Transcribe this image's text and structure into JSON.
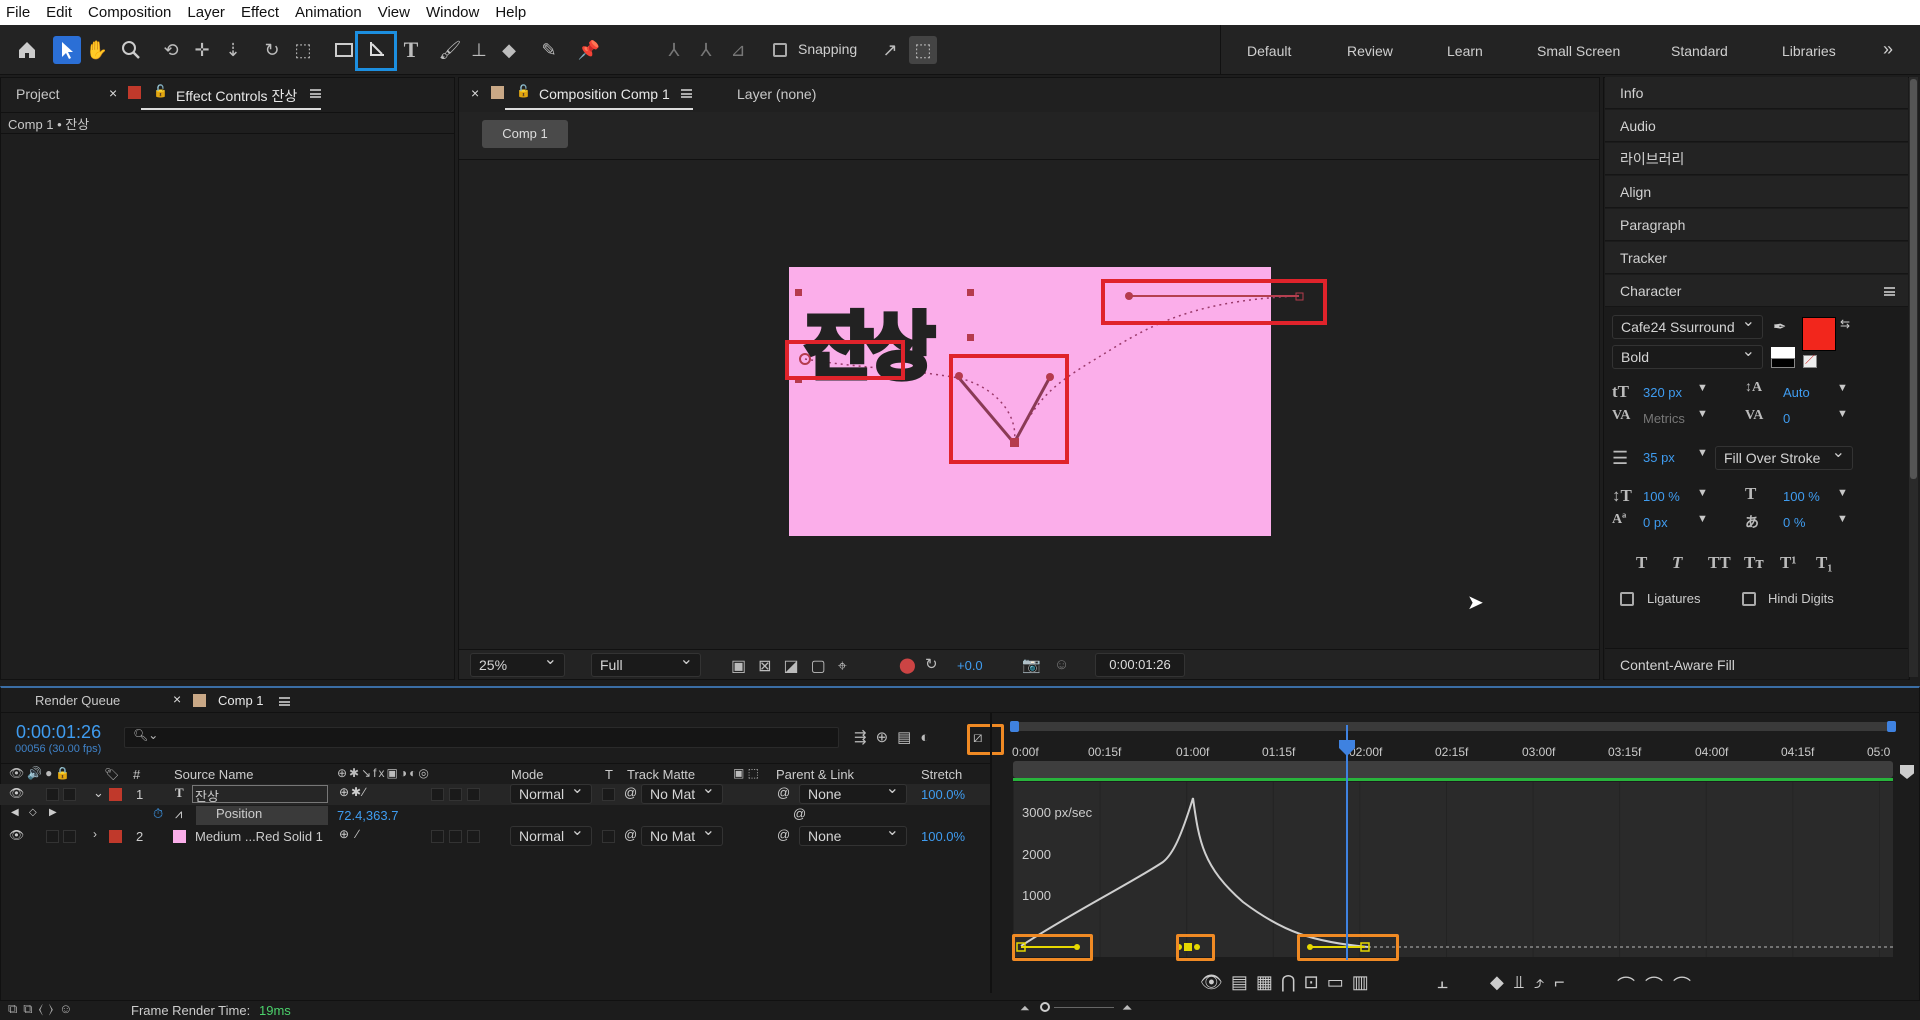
{
  "menu": [
    "File",
    "Edit",
    "Composition",
    "Layer",
    "Effect",
    "Animation",
    "View",
    "Window",
    "Help"
  ],
  "toolbar": {
    "snapping": "Snapping",
    "workspaces": [
      "Default",
      "Review",
      "Learn",
      "Small Screen",
      "Standard",
      "Libraries"
    ],
    "more": "»"
  },
  "left_panel": {
    "tab_project": "Project",
    "tab_effect": "Effect Controls 잔상",
    "breadcrumb": "Comp 1 • 잔상"
  },
  "comp_panel": {
    "tab_comp": "Composition Comp 1",
    "tab_layer": "Layer (none)",
    "comp_chip": "Comp 1",
    "text_layer": "잔상",
    "zoom": "25%",
    "resolution": "Full",
    "exposure": "+0.0",
    "timecode": "0:00:01:26"
  },
  "right_panel": {
    "items": [
      "Info",
      "Audio",
      "라이브러리",
      "Align",
      "Paragraph",
      "Tracker"
    ],
    "character": "Character",
    "font": "Cafe24 Ssurround",
    "style": "Bold",
    "size": "320 px",
    "leading": "Auto",
    "kerning": "Metrics",
    "tracking": "0",
    "stroke_w": "35 px",
    "stroke_type": "Fill Over Stroke",
    "vscale": "100 %",
    "hscale": "100 %",
    "baseline": "0 px",
    "tsume": "0 %",
    "type_buttons": [
      "T",
      "T",
      "TT",
      "Tт",
      "T¹",
      "T₁"
    ],
    "ligatures": "Ligatures",
    "hindi": "Hindi Digits",
    "caf": "Content-Aware Fill",
    "fill_color": "#f2261c"
  },
  "timeline": {
    "tab_rq": "Render Queue",
    "tab_comp": "Comp 1",
    "timecode": "0:00:01:26",
    "frames": "00056 (30.00 fps)",
    "cols": {
      "num": "#",
      "source": "Source Name",
      "mode": "Mode",
      "t": "T",
      "track": "Track Matte",
      "parent": "Parent & Link",
      "stretch": "Stretch"
    },
    "layers": [
      {
        "num": "1",
        "type": "T",
        "name": "잔상",
        "mode": "Normal",
        "matte": "No Mat",
        "parent": "None",
        "stretch": "100.0%",
        "color": "#c0392b"
      },
      {
        "num": "2",
        "type": "",
        "name": "Medium ...Red Solid 1",
        "mode": "Normal",
        "matte": "No Mat",
        "parent": "None",
        "stretch": "100.0%",
        "color": "#c0392b"
      }
    ],
    "property": {
      "name": "Position",
      "value": "72.4,363.7"
    },
    "ruler": [
      "0:00f",
      "00:15f",
      "01:00f",
      "01:15f",
      "02:00f",
      "02:15f",
      "03:00f",
      "03:15f",
      "04:00f",
      "04:15f",
      "05:0"
    ],
    "graph_labels": [
      "3000 px/sec",
      "2000",
      "1000"
    ],
    "render_time_label": "Frame Render Time:",
    "render_time": "19ms"
  }
}
